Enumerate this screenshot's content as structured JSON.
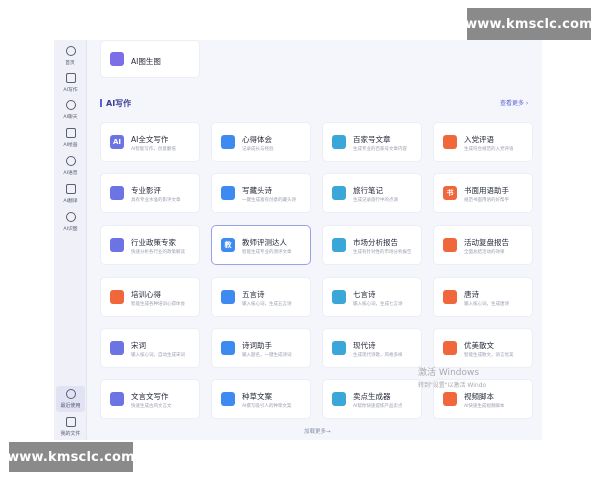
{
  "watermarks": {
    "top": "www.kmsclc.com",
    "bottom": "www.kmsclc.com"
  },
  "sidebar": {
    "items": [
      {
        "label": "首页",
        "icon": "home-icon"
      },
      {
        "label": "AI写作",
        "icon": "pen-icon"
      },
      {
        "label": "AI聊天",
        "icon": "chat-icon"
      },
      {
        "label": "AI绘画",
        "icon": "brush-icon"
      },
      {
        "label": "AI语音",
        "icon": "headphones-icon"
      },
      {
        "label": "AI翻译",
        "icon": "translate-icon"
      },
      {
        "label": "AI识图",
        "icon": "scan-icon"
      }
    ],
    "bottom": [
      {
        "label": "最近使用",
        "icon": "clock-icon",
        "active": true
      },
      {
        "label": "我的文件",
        "icon": "file-icon",
        "active": false
      }
    ]
  },
  "top_card": {
    "title": "AI图生图",
    "icon": "image-icon",
    "color": "#7b6ee6"
  },
  "section": {
    "title": "AI写作",
    "see_more": "查看更多 ›"
  },
  "cards": [
    {
      "title": "AI全文写作",
      "desc": "AI智能写作，创意翻倍",
      "color": "#6c73e2",
      "icon_text": "AI"
    },
    {
      "title": "心得体会",
      "desc": "记录成长与经验",
      "color": "#3d8af0",
      "icon_text": ""
    },
    {
      "title": "百家号文章",
      "desc": "生成专业的百家号文章内容",
      "color": "#3aa7d8",
      "icon_text": ""
    },
    {
      "title": "入党评语",
      "desc": "生成符合规范的入党评语",
      "color": "#f0673c",
      "icon_text": ""
    },
    {
      "title": "专业影评",
      "desc": "具有专业水准的影评文章",
      "color": "#6c73e2",
      "icon_text": ""
    },
    {
      "title": "写藏头诗",
      "desc": "一键生成富有创意的藏头诗",
      "color": "#3d8af0",
      "icon_text": ""
    },
    {
      "title": "旅行笔记",
      "desc": "生成记录旅行中的点滴",
      "color": "#3aa7d8",
      "icon_text": ""
    },
    {
      "title": "书面用语助手",
      "desc": "规范书面用语的好帮手",
      "color": "#f0673c",
      "icon_text": "书"
    },
    {
      "title": "行业政策专家",
      "desc": "快速分析各行业的政策解读",
      "color": "#6c73e2",
      "icon_text": ""
    },
    {
      "title": "教师评测达人",
      "desc": "智能生成专业的测评文章",
      "color": "#3d8af0",
      "icon_text": "教"
    },
    {
      "title": "市场分析报告",
      "desc": "生成有针对性的市场分析报告",
      "color": "#3aa7d8",
      "icon_text": ""
    },
    {
      "title": "活动复盘报告",
      "desc": "全面总结活动的效果",
      "color": "#f0673c",
      "icon_text": ""
    },
    {
      "title": "培训心得",
      "desc": "智能生成各种培训心得体会",
      "color": "#f0673c",
      "icon_text": ""
    },
    {
      "title": "五言诗",
      "desc": "输入核心词，生成五言诗",
      "color": "#3d8af0",
      "icon_text": ""
    },
    {
      "title": "七言诗",
      "desc": "输入核心词，生成七言诗",
      "color": "#3aa7d8",
      "icon_text": ""
    },
    {
      "title": "唐诗",
      "desc": "输入核心词，生成唐诗",
      "color": "#f0673c",
      "icon_text": ""
    },
    {
      "title": "宋词",
      "desc": "输入核心词，自动生成宋词",
      "color": "#6c73e2",
      "icon_text": ""
    },
    {
      "title": "诗词助手",
      "desc": "输入题名，一键生成诗词",
      "color": "#3d8af0",
      "icon_text": ""
    },
    {
      "title": "现代诗",
      "desc": "生成现代诗歌，风格多样",
      "color": "#3aa7d8",
      "icon_text": ""
    },
    {
      "title": "优美散文",
      "desc": "智能生成散文，语言优美",
      "color": "#f0673c",
      "icon_text": ""
    },
    {
      "title": "文言文写作",
      "desc": "快速生成古风文言文",
      "color": "#6c73e2",
      "icon_text": ""
    },
    {
      "title": "种草文案",
      "desc": "AI撰写吸引人的种草文案",
      "color": "#3d8af0",
      "icon_text": ""
    },
    {
      "title": "卖点生成器",
      "desc": "AI帮你快速提炼产品卖点",
      "color": "#3aa7d8",
      "icon_text": ""
    },
    {
      "title": "视频脚本",
      "desc": "AI快速生成视频脚本",
      "color": "#f0673c",
      "icon_text": ""
    }
  ],
  "selected_card": 9,
  "load_more": "加载更多→",
  "activate": {
    "line1": "激活 Windows",
    "line2": "转到\"设置\"以激活 Windo"
  }
}
